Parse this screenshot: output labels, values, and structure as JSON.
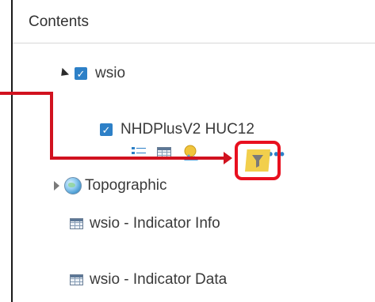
{
  "contents": {
    "title": "Contents",
    "group_layer": {
      "label": "wsio",
      "checked": "✓"
    },
    "sub_layer": {
      "label": "NHDPlusV2 HUC12",
      "checked": "✓"
    },
    "basemap": {
      "label": "Topographic"
    },
    "tables": [
      {
        "label": "wsio - Indicator Info"
      },
      {
        "label": "wsio - Indicator Data"
      }
    ],
    "tools": {
      "legend_icon": "legend-icon",
      "table_icon": "attribute-table-icon",
      "symbology_icon": "symbology-icon",
      "filter_icon": "filter-icon",
      "more_icon": "more-options-icon",
      "more_glyph": "•••"
    }
  },
  "colors": {
    "checkbox": "#2d80c7",
    "annotation_red": "#d1121f",
    "filter_tile": "#f2cf4c",
    "text": "#3a3a3a"
  }
}
